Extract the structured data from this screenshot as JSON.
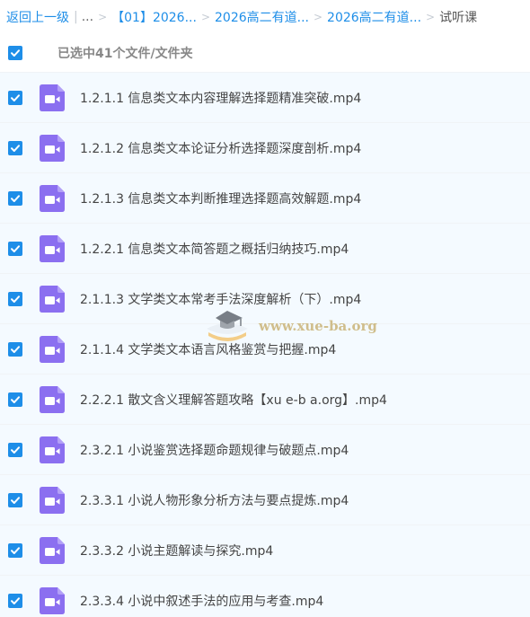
{
  "breadcrumb": {
    "back": "返回上一级",
    "ellipsis": "...",
    "items": [
      "【01】2026...",
      "2026高二有道...",
      "2026高二有道..."
    ],
    "current": "试听课"
  },
  "select_all": {
    "label": "已选中41个文件/文件夹",
    "checked": true
  },
  "files": [
    "1.2.1.1 信息类文本内容理解选择题精准突破.mp4",
    "1.2.1.2 信息类文本论证分析选择题深度剖析.mp4",
    "1.2.1.3 信息类文本判断推理选择题高效解题.mp4",
    "1.2.2.1 信息类文本简答题之概括归纳技巧.mp4",
    "2.1.1.3 文学类文本常考手法深度解析（下）.mp4",
    "2.1.1.4 文学类文本语言风格鉴赏与把握.mp4",
    "2.2.2.1 散文含义理解答题攻略【xu e-b a.org】.mp4",
    "2.3.2.1 小说鉴赏选择题命题规律与破题点.mp4",
    "2.3.3.1 小说人物形象分析方法与要点提炼.mp4",
    "2.3.3.2 小说主题解读与探究.mp4",
    "2.3.3.4 小说中叙述手法的应用与考查.mp4"
  ],
  "icons": {
    "checkbox": "checkbox-checked-icon",
    "file": "video-file-icon",
    "watermark": "graduation-cap-icon"
  },
  "colors": {
    "accent": "#1e8ee8",
    "video_icon": "#8b6ff0",
    "row_selected": "#f4faff"
  },
  "watermark": {
    "text": "www.xue-ba.org"
  }
}
